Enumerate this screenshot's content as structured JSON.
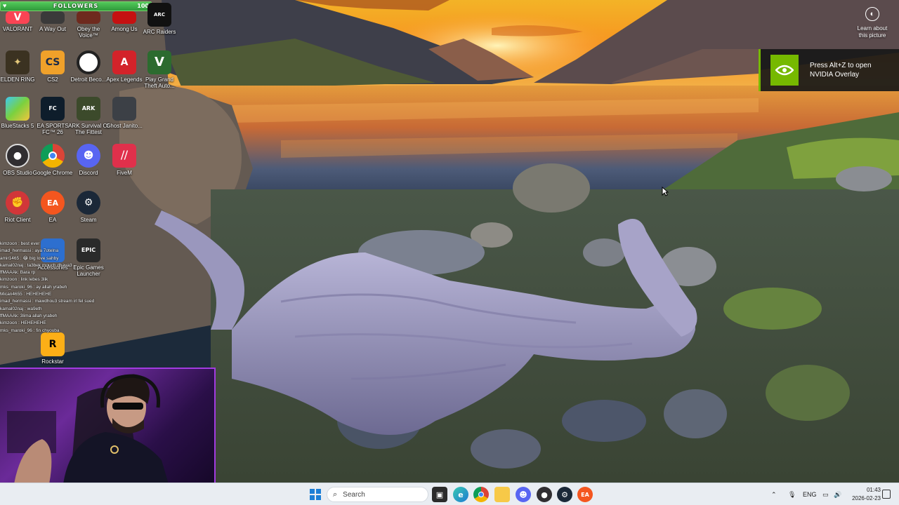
{
  "followers": {
    "label": "FOLLOWERS",
    "count": "100",
    "progress": 1.0
  },
  "desktop_icons": [
    {
      "label": "VALORANT"
    },
    {
      "label": "A Way Out"
    },
    {
      "label": "Obey the Voice™"
    },
    {
      "label": "Among Us"
    },
    {
      "label": "ARC Raiders"
    },
    {
      "label": "ELDEN RING"
    },
    {
      "label": "CS2"
    },
    {
      "label": "Detroit Beco..."
    },
    {
      "label": "Apex Legends"
    },
    {
      "label": "Play Grand Theft Auto..."
    },
    {
      "label": "BlueStacks 5"
    },
    {
      "label": "EA SPORTS FC™ 26"
    },
    {
      "label": "ARK Survival Of The Fittest"
    },
    {
      "label": "Ghost Janito..."
    },
    {
      "label": "OBS Studio"
    },
    {
      "label": "Google Chrome"
    },
    {
      "label": "Discord"
    },
    {
      "label": "FiveM"
    },
    {
      "label": "Riot Client"
    },
    {
      "label": "EA"
    },
    {
      "label": "Steam"
    },
    {
      "label": "Accessories"
    },
    {
      "label": "Epic Games Launcher"
    },
    {
      "label": "Rockstar"
    }
  ],
  "learn_more": {
    "text": "Learn about this picture"
  },
  "nvidia_toast": {
    "line1": "Press Alt+Z to open",
    "line2": "NVIDIA Overlay"
  },
  "chat": [
    {
      "text": "kimzoon : best ever"
    },
    {
      "text": "imad_hermassi : aya 7otelna"
    },
    {
      "text": "amir1465 : 😂 big love sahby"
    },
    {
      "text": "kamal02naj : ta3bek mouch dhaya3"
    },
    {
      "text": "ffMAAAk: Bara rp"
    },
    {
      "text": "kimzoon : link lebes 3lik"
    },
    {
      "text": "mks_maroki_96 : ay allah yrabeh"
    },
    {
      "text": "Mican4655 : HEHEHEHE"
    },
    {
      "text": "imad_hermassi : mawdhou3 stream irl fel sued"
    },
    {
      "text": "kamal02naj : wa9eth"
    },
    {
      "text": "ffMAAAk: 3lima allah yrabeh"
    },
    {
      "text": "kimzoon : HEHEHEHE"
    },
    {
      "text": "mks_maroki_96 : fin chyouba"
    }
  ],
  "taskbar": {
    "search_placeholder": "Search",
    "lang": "ENG",
    "time": "01:43",
    "date": "2026-02-23"
  },
  "colors": {
    "taskbar_bg": "#e9edf2",
    "nvidia_green": "#76b900",
    "followers_green": "#52c95a"
  }
}
